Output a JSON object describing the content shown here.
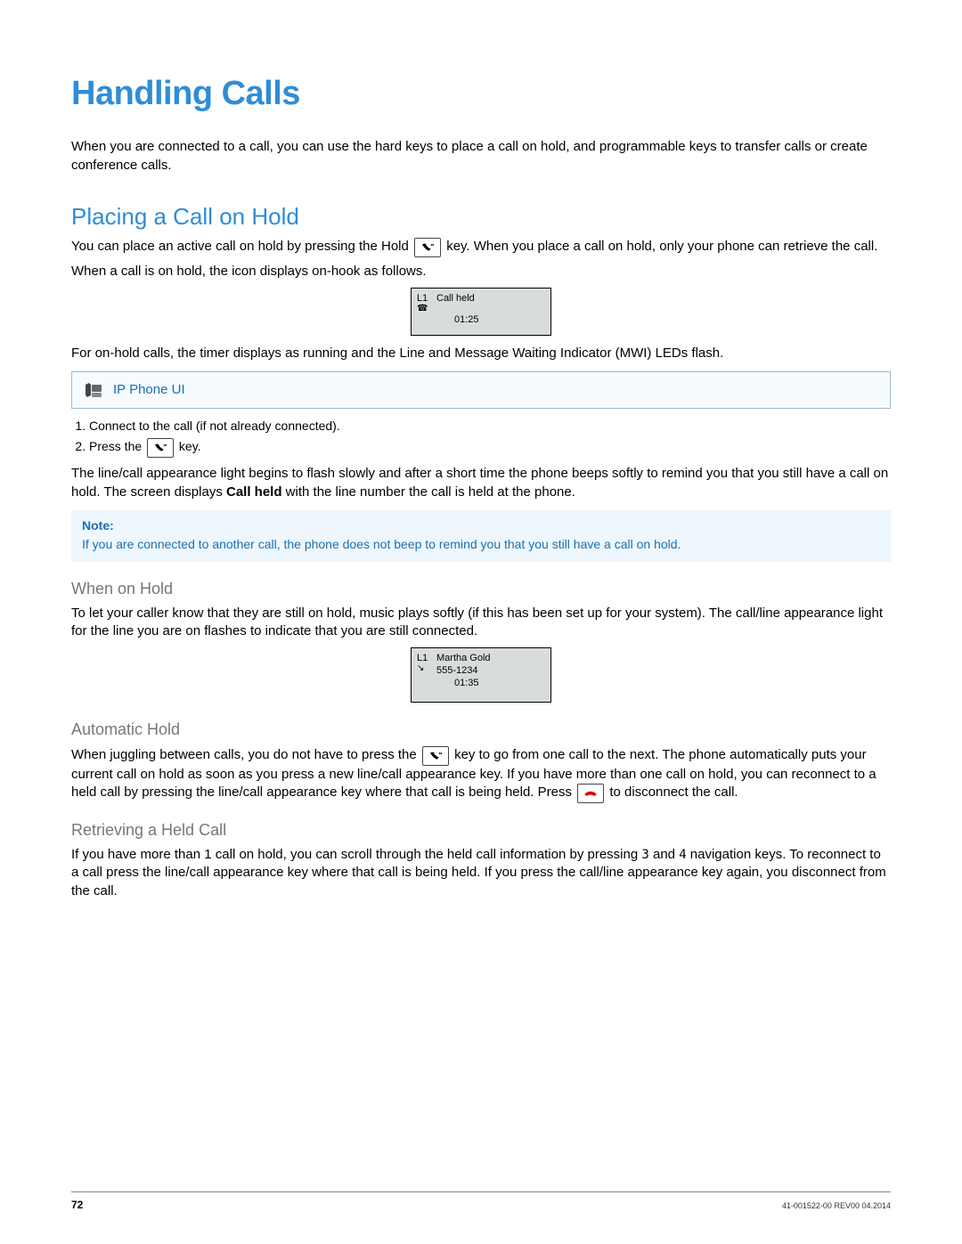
{
  "title": "Handling Calls",
  "intro": "When you are connected to a call, you can use the hard keys to place a call on hold, and programmable keys to transfer calls or create conference calls.",
  "section1": {
    "heading": "Placing a Call on Hold",
    "p1a": "You can place an active call on hold by pressing the Hold ",
    "p1b": " key. When you place a call on hold, only your phone can retrieve the call.",
    "p2": "When a call is on hold, the icon displays on-hook as follows.",
    "lcd1": {
      "line": "L1",
      "label": "Call held",
      "timer": "01:25"
    },
    "p3": "For on-hold calls, the timer displays as running and the Line and Message Waiting Indicator (MWI) LEDs flash.",
    "uiLabel": "IP Phone UI",
    "step1": "Connect to the call (if not already connected).",
    "step2a": "Press the ",
    "step2b": " key.",
    "p4a": "The line/call appearance light begins to flash slowly and after a short time the phone beeps softly to remind you that you still have a call on hold. The screen displays ",
    "p4bold": "Call held",
    "p4b": " with the line number the call is held at the phone.",
    "noteTitle": "Note:",
    "noteText": "If you are connected to another call, the phone does not beep to remind you that you still have a call on hold."
  },
  "sub1": {
    "heading": "When on Hold",
    "p": "To let your caller know that they are still on hold, music plays softly (if this has been set up for your system). The call/line appearance light for the line you are on flashes to indicate that you are still connected.",
    "lcd": {
      "line": "L1",
      "name": "Martha Gold",
      "number": "555-1234",
      "timer": "01:35"
    }
  },
  "sub2": {
    "heading": "Automatic Hold",
    "p1a": "When juggling between calls, you do not have to press the ",
    "p1b": " key to go from one call to the next. The phone automatically puts your current call on hold as soon as you press a new line/call appearance key. If you have more than one call on hold, you can reconnect to a held call by pressing the line/call appearance key where that call is being held. Press ",
    "p1c": " to disconnect the call."
  },
  "sub3": {
    "heading": "Retrieving a Held Call",
    "p_a": "If you have more than 1 call on hold, you can scroll through the held call information by pressing ",
    "nav3": "3",
    "p_mid": " and ",
    "nav4": "4",
    "p_b": " navigation keys. To reconnect to a call press the line/call appearance key where that call is being held. If you press the call/line appearance key again, you disconnect from the call."
  },
  "footer": {
    "page": "72",
    "rev": "41-001522-00 REV00   04.2014"
  }
}
